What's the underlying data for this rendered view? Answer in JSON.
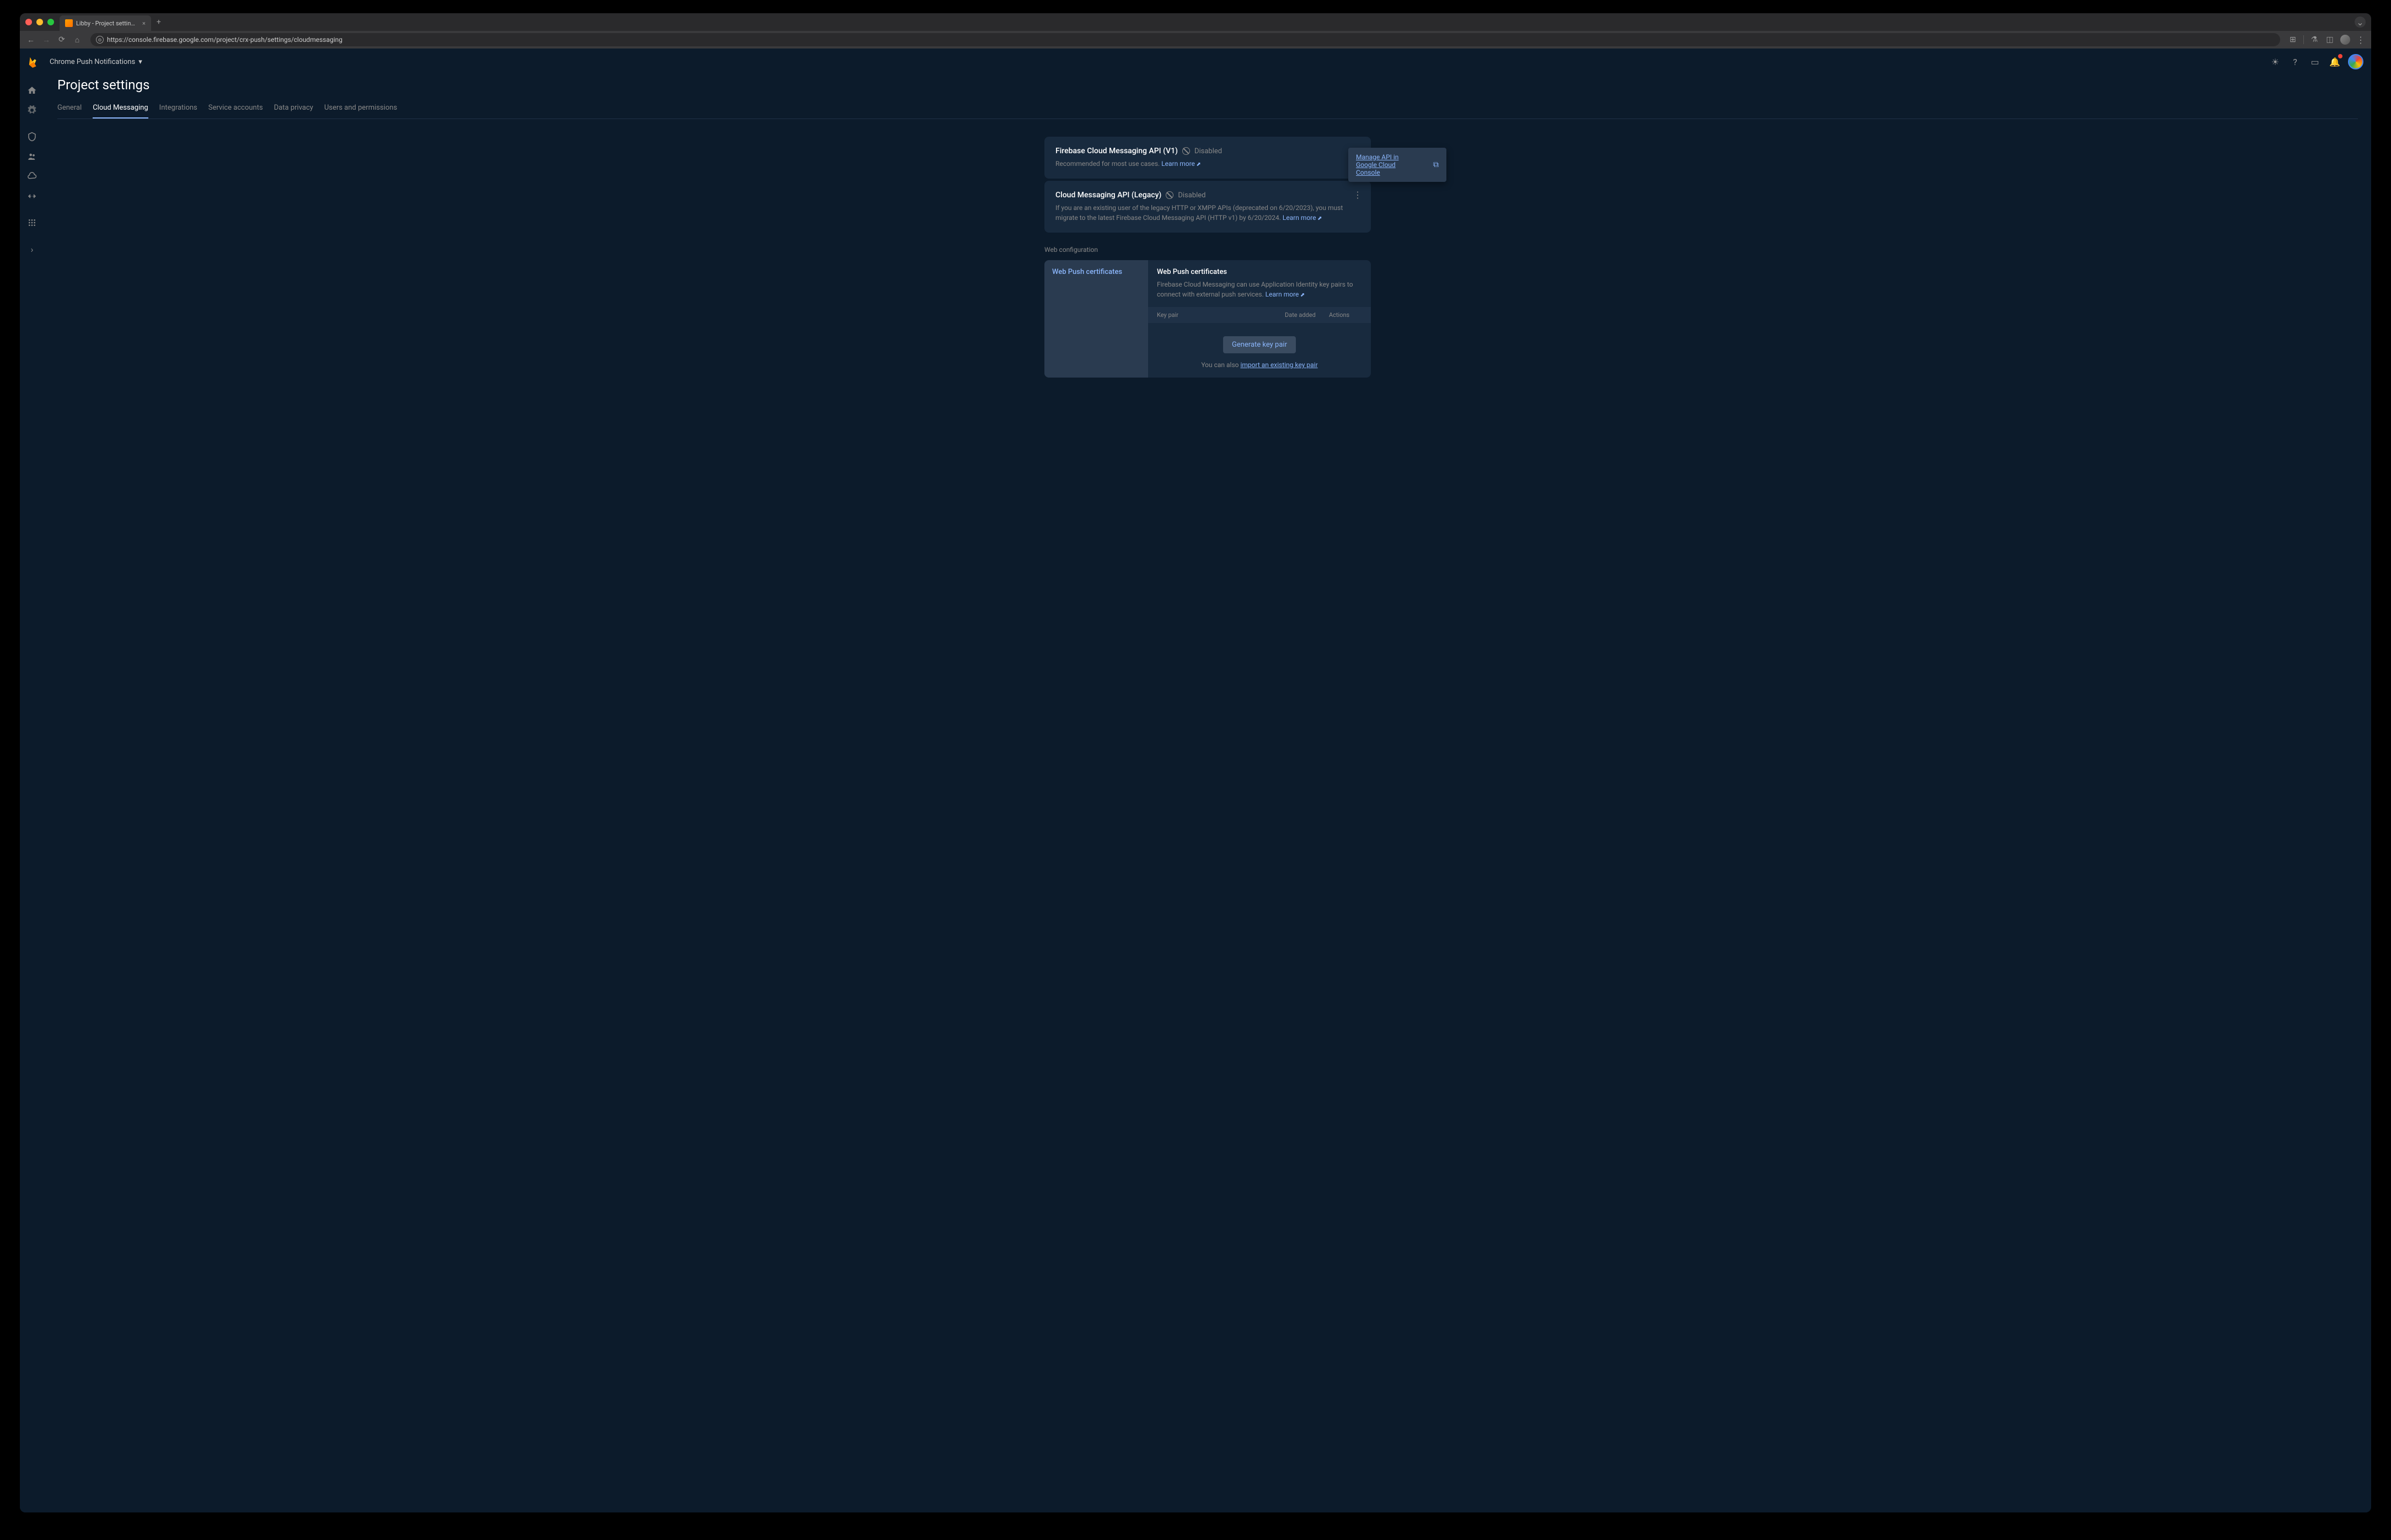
{
  "browser": {
    "tab_title": "Libby - Project settings - Fire",
    "url": "https://console.firebase.google.com/project/crx-push/settings/cloudmessaging"
  },
  "header": {
    "project_name": "Chrome Push Notifications"
  },
  "page": {
    "title": "Project settings",
    "tabs": [
      "General",
      "Cloud Messaging",
      "Integrations",
      "Service accounts",
      "Data privacy",
      "Users and permissions"
    ],
    "active_tab": "Cloud Messaging"
  },
  "cards": {
    "v1": {
      "title": "Firebase Cloud Messaging API (V1)",
      "status": "Disabled",
      "desc": "Recommended for most use cases.",
      "learn_more": "Learn more"
    },
    "legacy": {
      "title": "Cloud Messaging API (Legacy)",
      "status": "Disabled",
      "desc": "If you are an existing user of the legacy HTTP or XMPP APIs (deprecated on 6/20/2023), you must migrate to the latest Firebase Cloud Messaging API (HTTP v1) by 6/20/2024.",
      "learn_more": "Learn more"
    }
  },
  "popup": {
    "text": "Manage API in Google Cloud Console"
  },
  "webconfig": {
    "label": "Web configuration",
    "tab": "Web Push certificates",
    "title": "Web Push certificates",
    "desc": "Firebase Cloud Messaging can use Application Identity key pairs to connect with external push services.",
    "learn_more": "Learn more",
    "th_keypair": "Key pair",
    "th_date": "Date added",
    "th_actions": "Actions",
    "generate_btn": "Generate key pair",
    "import_prefix": "You can also ",
    "import_link": "import an existing key pair"
  }
}
